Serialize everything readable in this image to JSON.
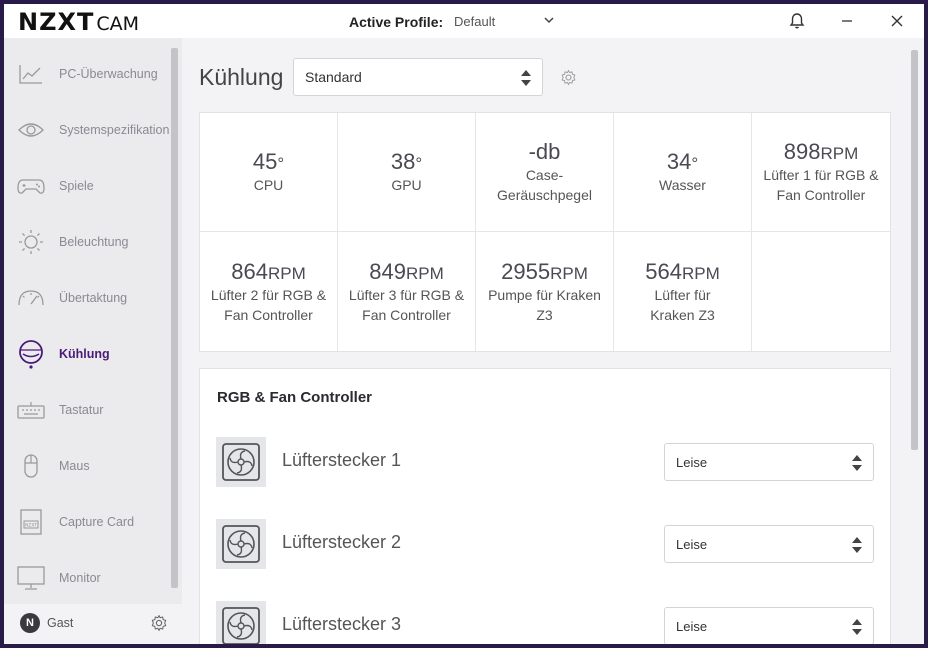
{
  "app": {
    "logo_main": "NZXT",
    "logo_sub": "CAM"
  },
  "header": {
    "profile_label": "Active Profile:",
    "profile_value": "Default"
  },
  "sidebar": {
    "items": [
      {
        "label": "PC-Überwachung",
        "icon": "line-chart-icon"
      },
      {
        "label": "Systemspezifikation",
        "icon": "eye-icon"
      },
      {
        "label": "Spiele",
        "icon": "gamepad-icon"
      },
      {
        "label": "Beleuchtung",
        "icon": "sun-icon"
      },
      {
        "label": "Übertaktung",
        "icon": "gauge-icon"
      },
      {
        "label": "Kühlung",
        "icon": "cooling-icon",
        "active": true
      },
      {
        "label": "Tastatur",
        "icon": "keyboard-icon"
      },
      {
        "label": "Maus",
        "icon": "mouse-icon"
      },
      {
        "label": "Capture Card",
        "icon": "capture-card-icon"
      },
      {
        "label": "Monitor",
        "icon": "monitor-icon"
      }
    ],
    "user": {
      "avatar": "N",
      "name": "Gast"
    }
  },
  "main": {
    "title": "Kühlung",
    "mode_select": "Standard",
    "stats": [
      {
        "value": "45",
        "unit": "°",
        "name": "CPU"
      },
      {
        "value": "38",
        "unit": "°",
        "name": "GPU"
      },
      {
        "value": "-db",
        "unit": "",
        "name": "Case-Geräuschpegel"
      },
      {
        "value": "34",
        "unit": "°",
        "name": "Wasser"
      },
      {
        "value": "898",
        "unit": "RPM",
        "name": "Lüfter 1 für RGB & Fan Controller"
      },
      {
        "value": "864",
        "unit": "RPM",
        "name": "Lüfter 2 für RGB & Fan Controller"
      },
      {
        "value": "849",
        "unit": "RPM",
        "name": "Lüfter 3 für RGB & Fan Controller"
      },
      {
        "value": "2955",
        "unit": "RPM",
        "name": "Pumpe für Kraken Z3"
      },
      {
        "value": "564",
        "unit": "RPM",
        "name": "Lüfter für Kraken Z3"
      }
    ],
    "panel": {
      "title": "RGB & Fan Controller",
      "fans": [
        {
          "label": "Lüfterstecker 1",
          "mode": "Leise"
        },
        {
          "label": "Lüfterstecker 2",
          "mode": "Leise"
        },
        {
          "label": "Lüfterstecker 3",
          "mode": "Leise"
        }
      ]
    }
  },
  "colors": {
    "accent": "#4a1a7a",
    "sidebar_bg": "#ebebed",
    "panel_bg": "#ffffff"
  }
}
